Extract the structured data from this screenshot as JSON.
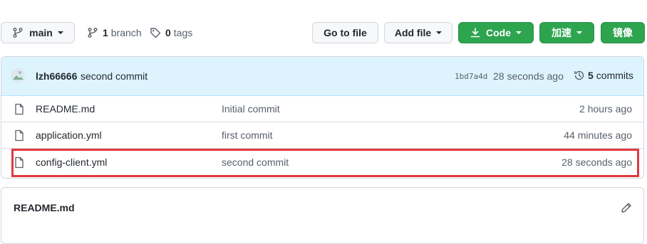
{
  "toolbar": {
    "branch_button": "main",
    "branches_count": "1",
    "branches_label": "branch",
    "tags_count": "0",
    "tags_label": "tags",
    "go_to_file": "Go to file",
    "add_file": "Add file",
    "code": "Code",
    "accelerate": "加速",
    "mirror": "镜像"
  },
  "latest_commit": {
    "author": "lzh66666",
    "message": "second commit",
    "sha": "1bd7a4d",
    "time": "28 seconds ago",
    "commits_count": "5",
    "commits_label": "commits"
  },
  "files": [
    {
      "name": "README.md",
      "message": "Initial commit",
      "time": "2 hours ago"
    },
    {
      "name": "application.yml",
      "message": "first commit",
      "time": "44 minutes ago"
    },
    {
      "name": "config-client.yml",
      "message": "second commit",
      "time": "28 seconds ago"
    }
  ],
  "readme": {
    "title": "README.md"
  },
  "colors": {
    "green": "#2da44e",
    "header_blue": "#ddf4ff",
    "highlight_red": "#e03a3e"
  }
}
